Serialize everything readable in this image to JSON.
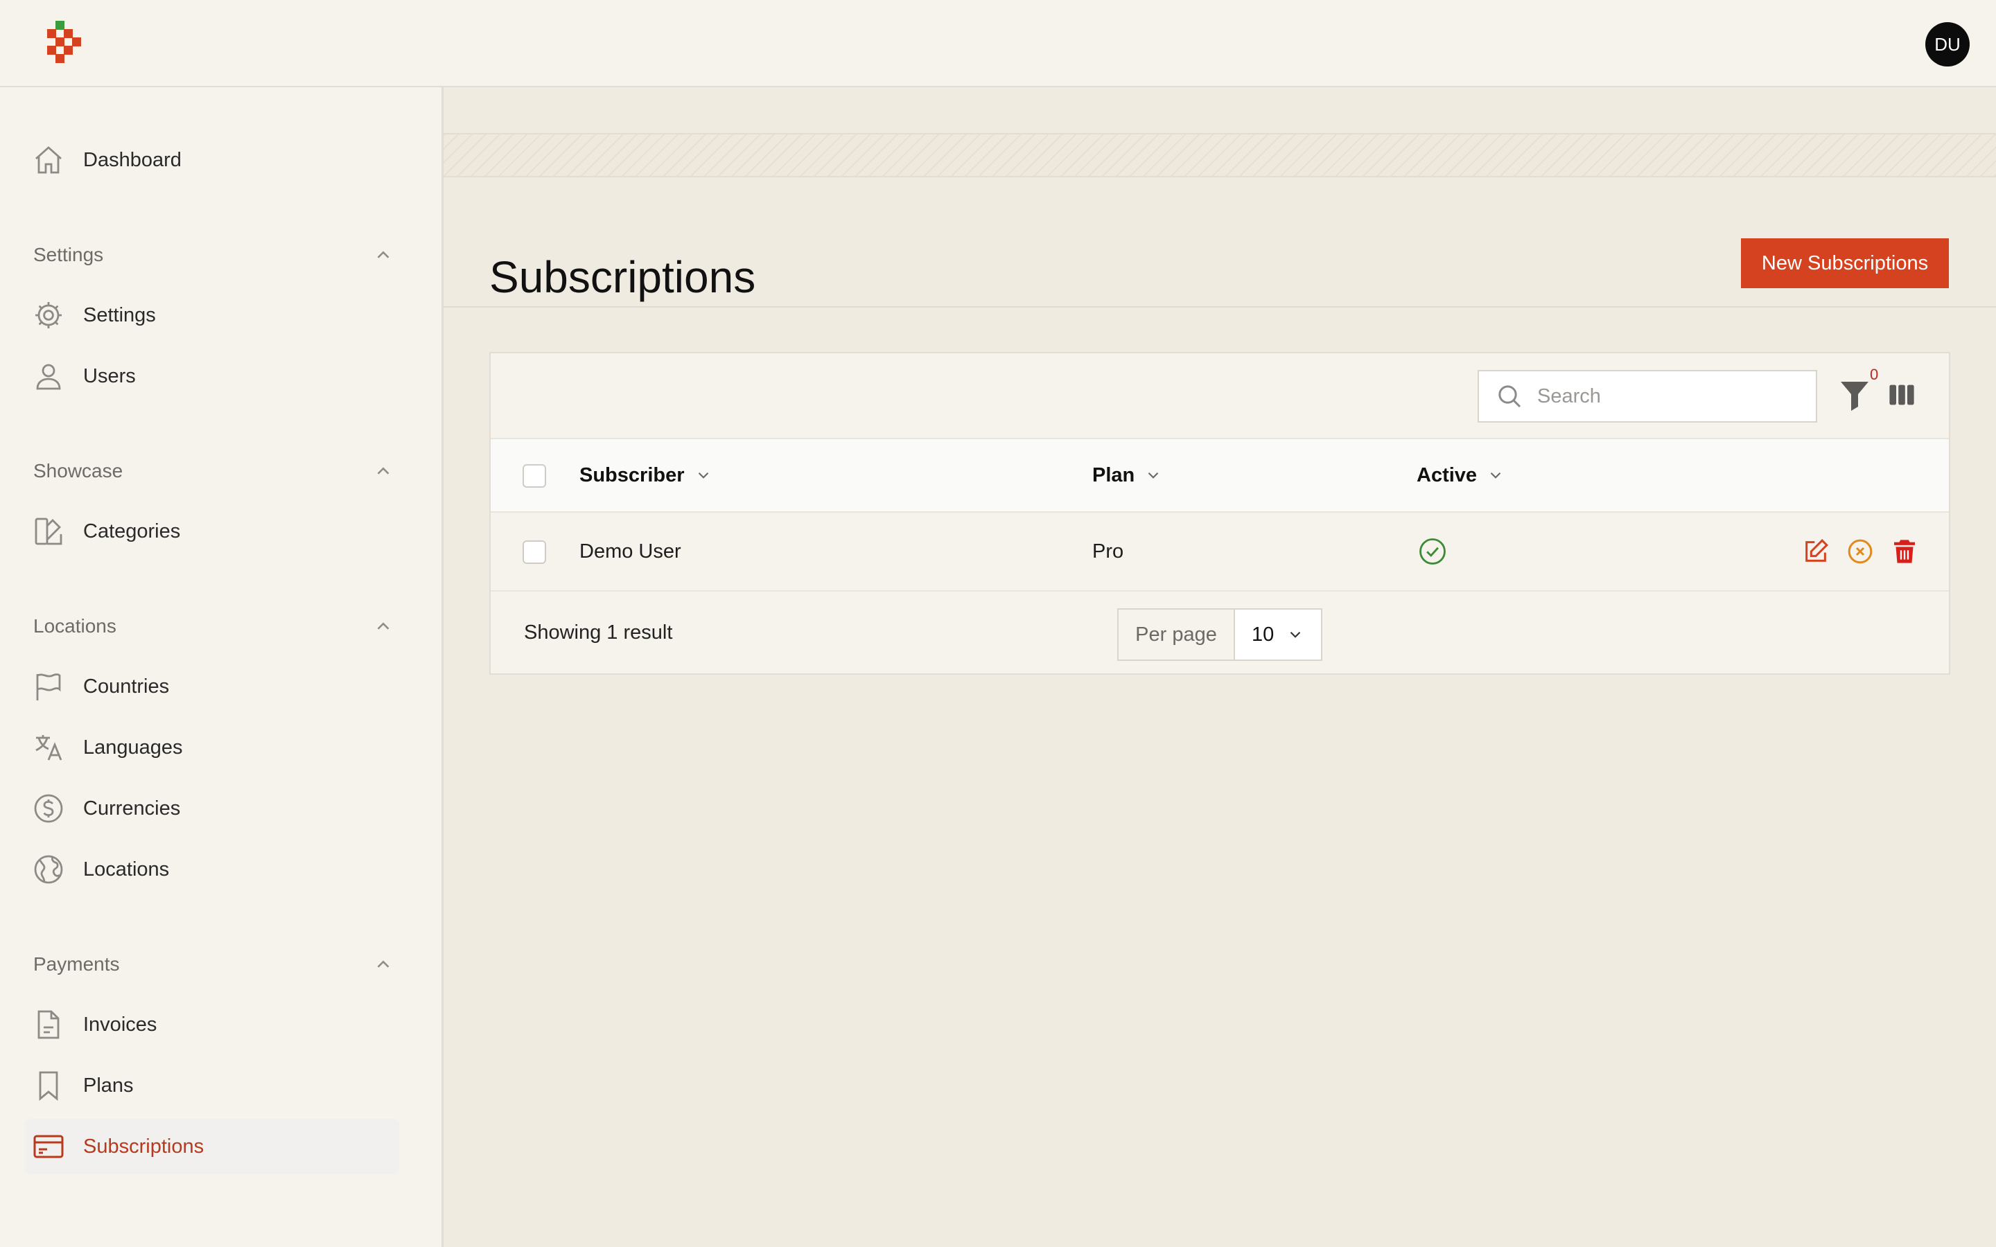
{
  "header": {
    "avatar_initials": "DU"
  },
  "sidebar": {
    "dashboard": {
      "label": "Dashboard",
      "icon": "home-icon"
    },
    "groups": {
      "settings": {
        "title": "Settings",
        "items": [
          {
            "label": "Settings",
            "icon": "gear-icon"
          },
          {
            "label": "Users",
            "icon": "user-icon"
          }
        ]
      },
      "showcase": {
        "title": "Showcase",
        "items": [
          {
            "label": "Categories",
            "icon": "categories-icon"
          }
        ]
      },
      "locations": {
        "title": "Locations",
        "items": [
          {
            "label": "Countries",
            "icon": "flag-icon"
          },
          {
            "label": "Languages",
            "icon": "translate-icon"
          },
          {
            "label": "Currencies",
            "icon": "dollar-icon"
          },
          {
            "label": "Locations",
            "icon": "globe-icon"
          }
        ]
      },
      "payments": {
        "title": "Payments",
        "items": [
          {
            "label": "Invoices",
            "icon": "document-icon"
          },
          {
            "label": "Plans",
            "icon": "bookmark-icon"
          },
          {
            "label": "Subscriptions",
            "icon": "credit-card-icon",
            "active": true
          }
        ]
      }
    }
  },
  "main": {
    "title": "Subscriptions",
    "new_button": "New Subscriptions",
    "accent_color": "#d4421f"
  },
  "table": {
    "search_placeholder": "Search",
    "filter_count": "0",
    "columns": [
      "Subscriber",
      "Plan",
      "Active"
    ],
    "rows": [
      {
        "subscriber": "Demo User",
        "plan": "Pro",
        "active": true
      }
    ],
    "footer": {
      "showing": "Showing 1 result",
      "per_page_label": "Per page",
      "per_page_value": "10"
    }
  }
}
